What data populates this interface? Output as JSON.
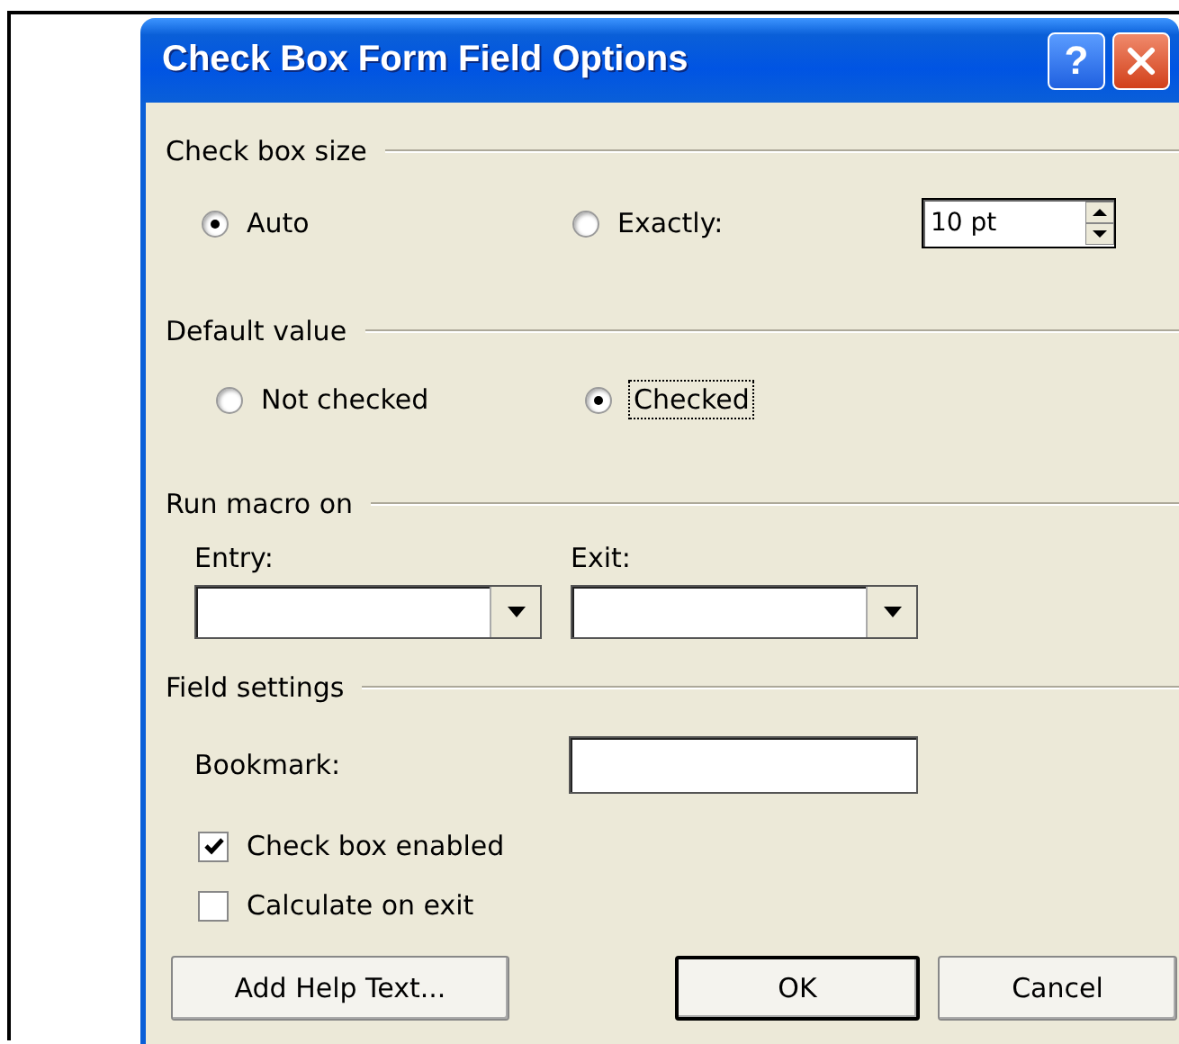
{
  "window": {
    "title": "Check Box Form Field Options",
    "help_button": "?"
  },
  "check_box_size": {
    "label": "Check box size",
    "options": [
      {
        "label": "Auto",
        "selected": true
      },
      {
        "label": "Exactly:",
        "selected": false
      }
    ],
    "size_field": {
      "value": "10 pt"
    }
  },
  "default_value": {
    "label": "Default value",
    "options": [
      {
        "label": "Not checked",
        "selected": false,
        "focused": false
      },
      {
        "label": "Checked",
        "selected": true,
        "focused": true
      }
    ]
  },
  "run_macro_on": {
    "label": "Run macro on",
    "entry": {
      "label": "Entry:"
    },
    "exit": {
      "label": "Exit:"
    }
  },
  "field_settings": {
    "label": "Field settings",
    "bookmark": {
      "label": "Bookmark:"
    },
    "checkboxes": [
      {
        "label": "Check box enabled",
        "checked": true
      },
      {
        "label": "Calculate on exit",
        "checked": false
      }
    ]
  },
  "buttons": [
    {
      "label": "Add Help Text...",
      "default": false
    },
    {
      "label": "OK",
      "default": true
    },
    {
      "label": "Cancel",
      "default": false
    }
  ]
}
